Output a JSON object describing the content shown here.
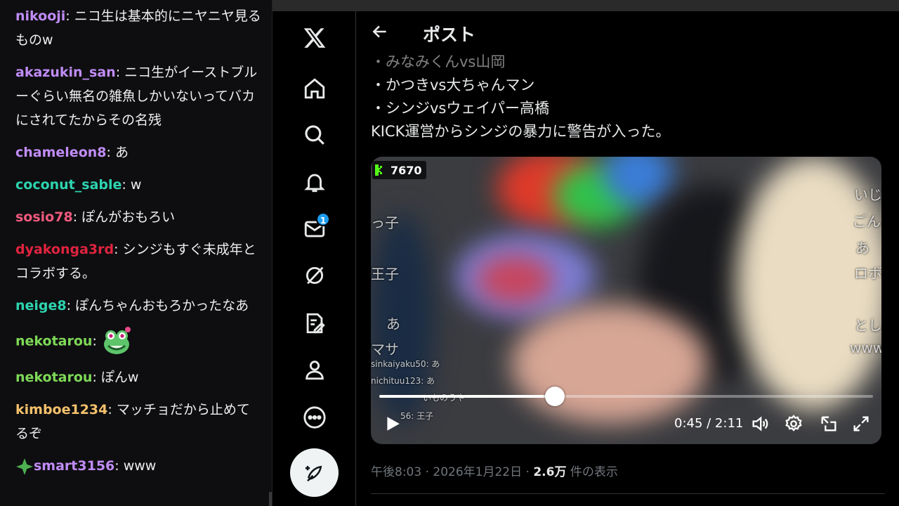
{
  "chat": {
    "messages": [
      {
        "user": "nikooji",
        "color": "#c08cf5",
        "text": "ニコ生は基本的にニヤニヤ見るものw"
      },
      {
        "user": "akazukin_san",
        "color": "#c08cf5",
        "text": "ニコ生がイーストブルーぐらい無名の雑魚しかいないってバカにされてたからその名残"
      },
      {
        "user": "chameleon8",
        "color": "#c08cf5",
        "text": "あ"
      },
      {
        "user": "coconut_sable",
        "color": "#2dd4b0",
        "text": "w"
      },
      {
        "user": "sosio78",
        "color": "#f05a7e",
        "text": "ぽんがおもろい"
      },
      {
        "user": "dyakonga3rd",
        "color": "#e0233f",
        "text": "シンジもすぐ未成年とコラボする。"
      },
      {
        "user": "neige8",
        "color": "#2dd4b0",
        "text": "ぽんちゃんおもろかったなあ"
      },
      {
        "user": "nekotarou",
        "color": "#7ed957",
        "text": "",
        "emote": "frog-emote"
      },
      {
        "user": "nekotarou",
        "color": "#7ed957",
        "text": "ぽんw"
      },
      {
        "user": "kimboe1234",
        "color": "#f5c16b",
        "text": "マッチョだから止めてるぞ"
      },
      {
        "user": "smart3156",
        "color": "#c08cf5",
        "text": "www",
        "badge": "star-badge"
      }
    ]
  },
  "nav": {
    "items": [
      {
        "name": "x-logo-icon"
      },
      {
        "name": "home-icon"
      },
      {
        "name": "explore-icon"
      },
      {
        "name": "notifications-icon"
      },
      {
        "name": "messages-icon",
        "badge": "1"
      },
      {
        "name": "grok-icon"
      },
      {
        "name": "premium-icon"
      },
      {
        "name": "profile-icon"
      },
      {
        "name": "more-icon"
      }
    ],
    "compose_icon": "compose-icon"
  },
  "header": {
    "title": "ポスト"
  },
  "tweet": {
    "lines": [
      "・みなみくんvs山岡",
      "・かつきvs大ちゃんマン",
      "・シンジvsウェイパー高橋",
      "KICK運営からシンジの暴力に警告が入った。"
    ],
    "video": {
      "kick_count": "7670",
      "time": "0:45 / 2:11",
      "progress": 0.356,
      "overlay_comments": [
        "っ子",
        "王子",
        "あ",
        "マサ",
        "ロボ",
        "いじ",
        "ごん",
        "あ",
        "とし",
        "www",
        "sinkaiyaku50: あ",
        "nichituu123: あ",
        "いものうや",
        "56: 王子"
      ]
    },
    "meta": {
      "time": "午後8:03",
      "date": "2026年1月22日",
      "views": "2.6万",
      "views_label": "件の表示",
      "sep": "·"
    }
  },
  "colors": {
    "accent": "#1d9bf0",
    "kick_green": "#53fc18"
  }
}
